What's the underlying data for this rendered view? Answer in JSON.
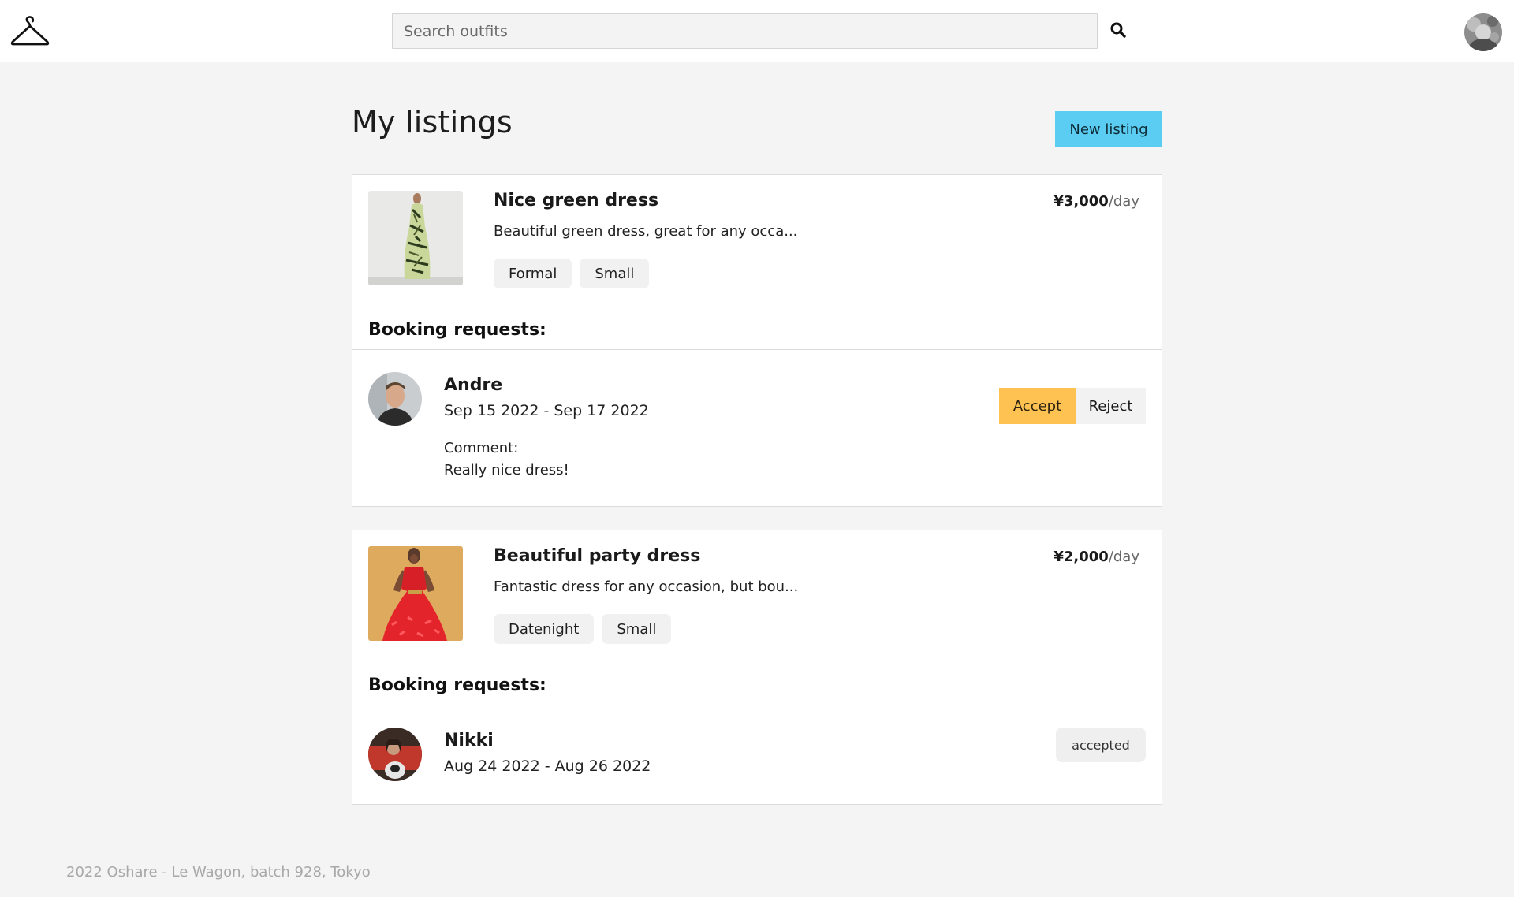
{
  "navbar": {
    "logo_icon": "hanger-icon",
    "search_placeholder": "Search outfits",
    "search_icon": "search-icon",
    "avatar_icon": "user-avatar"
  },
  "page": {
    "title": "My listings",
    "new_listing_label": "New listing"
  },
  "listings": [
    {
      "title": "Nice green dress",
      "description": "Beautiful green dress, great for any occa...",
      "tags": [
        "Formal",
        "Small"
      ],
      "price_amount": "¥3,000",
      "price_unit": "/day",
      "booking_heading": "Booking requests:",
      "request": {
        "name": "Andre",
        "dates": "Sep 15 2022 - Sep 17 2022",
        "comment_label": "Comment:",
        "comment": "Really nice dress!",
        "accept_label": "Accept",
        "reject_label": "Reject"
      }
    },
    {
      "title": "Beautiful party dress",
      "description": "Fantastic dress for any occasion, but bou...",
      "tags": [
        "Datenight",
        "Small"
      ],
      "price_amount": "¥2,000",
      "price_unit": "/day",
      "booking_heading": "Booking requests:",
      "request": {
        "name": "Nikki",
        "dates": "Aug 24 2022 - Aug 26 2022",
        "status": "accepted"
      }
    }
  ],
  "footer": {
    "text": "2022 Oshare - Le Wagon, batch 928, Tokyo"
  },
  "colors": {
    "accent_new_listing": "#5bcdf2",
    "accent_accept": "#fdc251",
    "page_background": "#f4f4f4"
  }
}
